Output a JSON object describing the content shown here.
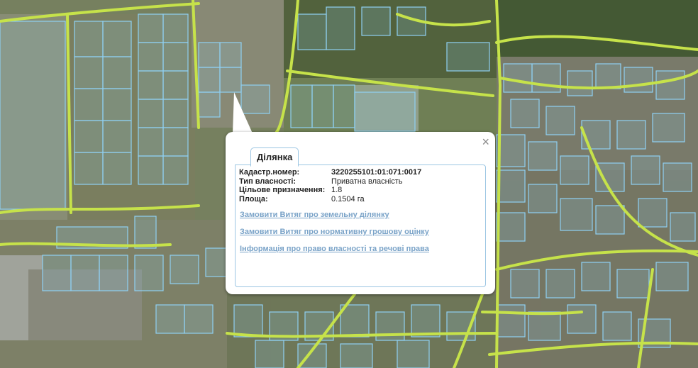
{
  "popup": {
    "tab_label": "Ділянка",
    "close_symbol": "×",
    "fields": [
      {
        "label": "Кадастр.номер:",
        "value": "3220255101:01:071:0017"
      },
      {
        "label": "Тип власності:",
        "value": "Приватна власність"
      },
      {
        "label": "Цільове призначення:",
        "value": "1.8"
      },
      {
        "label": "Площа:",
        "value": "0.1504 га"
      }
    ],
    "links": [
      "Замовити Витяг про земельну ділянку",
      "Замовити Витяг про нормативну грошову оцінку",
      "Інформація про право власності та речові права"
    ]
  },
  "colors": {
    "parcel_outline": "#8fd0f2",
    "road": "#c6e24a",
    "link": "#7aa3c8",
    "tab_border": "#9cc6e3"
  }
}
